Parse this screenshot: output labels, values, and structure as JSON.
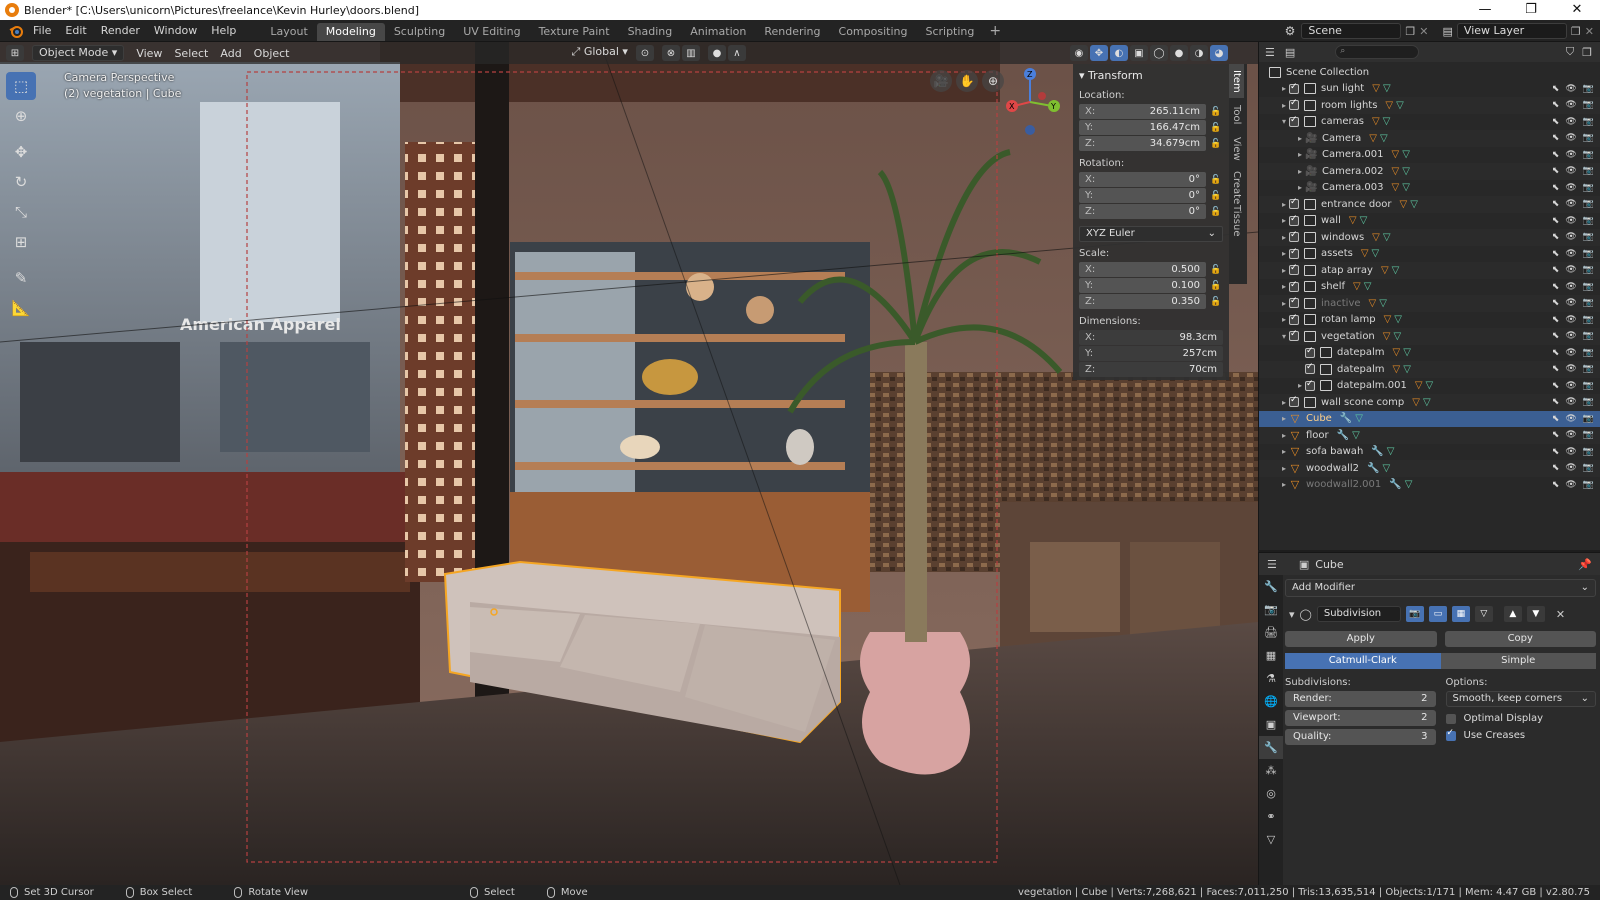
{
  "window": {
    "title": "Blender* [C:\\Users\\unicorn\\Pictures\\freelance\\Kevin Hurley\\doors.blend]",
    "minimize": "—",
    "maximize": "❐",
    "close": "✕"
  },
  "menu": [
    "File",
    "Edit",
    "Render",
    "Window",
    "Help"
  ],
  "workspaces": [
    {
      "label": "Layout",
      "active": false
    },
    {
      "label": "Modeling",
      "active": true
    },
    {
      "label": "Sculpting",
      "active": false
    },
    {
      "label": "UV Editing",
      "active": false
    },
    {
      "label": "Texture Paint",
      "active": false
    },
    {
      "label": "Shading",
      "active": false
    },
    {
      "label": "Animation",
      "active": false
    },
    {
      "label": "Rendering",
      "active": false
    },
    {
      "label": "Compositing",
      "active": false
    },
    {
      "label": "Scripting",
      "active": false
    }
  ],
  "workspace_add": "+",
  "scene_name": "Scene",
  "view_layer": "View Layer",
  "viewport": {
    "mode": "Object Mode",
    "menus": [
      "View",
      "Select",
      "Add",
      "Object"
    ],
    "orientation": "Global",
    "overlay_line1": "Camera Perspective",
    "overlay_line2": "(2) vegetation | Cube",
    "sign_text": "American Apparel"
  },
  "npanel": {
    "title": "Transform",
    "location_label": "Location:",
    "location": [
      {
        "axis": "X:",
        "value": "265.11cm"
      },
      {
        "axis": "Y:",
        "value": "166.47cm"
      },
      {
        "axis": "Z:",
        "value": "34.679cm"
      }
    ],
    "rotation_label": "Rotation:",
    "rotation": [
      {
        "axis": "X:",
        "value": "0°"
      },
      {
        "axis": "Y:",
        "value": "0°"
      },
      {
        "axis": "Z:",
        "value": "0°"
      }
    ],
    "rotation_mode": "XYZ Euler",
    "scale_label": "Scale:",
    "scale": [
      {
        "axis": "X:",
        "value": "0.500"
      },
      {
        "axis": "Y:",
        "value": "0.100"
      },
      {
        "axis": "Z:",
        "value": "0.350"
      }
    ],
    "dimensions_label": "Dimensions:",
    "dimensions": [
      {
        "axis": "X:",
        "value": "98.3cm"
      },
      {
        "axis": "Y:",
        "value": "257cm"
      },
      {
        "axis": "Z:",
        "value": "70cm"
      }
    ],
    "tabs": [
      "Item",
      "Tool",
      "View",
      "Create",
      "Tissue"
    ]
  },
  "outliner": {
    "root": "Scene Collection",
    "items": [
      {
        "name": "sun light",
        "kind": "collection",
        "depth": 1,
        "arrow": "▸",
        "state": "normal"
      },
      {
        "name": "room lights",
        "kind": "collection",
        "depth": 1,
        "arrow": "▸",
        "state": "normal"
      },
      {
        "name": "cameras",
        "kind": "collection",
        "depth": 1,
        "arrow": "▾",
        "state": "normal"
      },
      {
        "name": "Camera",
        "kind": "camera",
        "depth": 2,
        "arrow": "▸",
        "state": "normal"
      },
      {
        "name": "Camera.001",
        "kind": "camera",
        "depth": 2,
        "arrow": "▸",
        "state": "normal"
      },
      {
        "name": "Camera.002",
        "kind": "camera",
        "depth": 2,
        "arrow": "▸",
        "state": "normal"
      },
      {
        "name": "Camera.003",
        "kind": "camera",
        "depth": 2,
        "arrow": "▸",
        "state": "normal"
      },
      {
        "name": "entrance door",
        "kind": "collection",
        "depth": 1,
        "arrow": "▸",
        "state": "normal"
      },
      {
        "name": "wall",
        "kind": "collection",
        "depth": 1,
        "arrow": "▸",
        "state": "normal"
      },
      {
        "name": "windows",
        "kind": "collection",
        "depth": 1,
        "arrow": "▸",
        "state": "normal"
      },
      {
        "name": "assets",
        "kind": "collection",
        "depth": 1,
        "arrow": "▸",
        "state": "normal"
      },
      {
        "name": "atap array",
        "kind": "collection",
        "depth": 1,
        "arrow": "▸",
        "state": "normal"
      },
      {
        "name": "shelf",
        "kind": "collection",
        "depth": 1,
        "arrow": "▸",
        "state": "normal"
      },
      {
        "name": "inactive",
        "kind": "collection",
        "depth": 1,
        "arrow": "▸",
        "state": "dim"
      },
      {
        "name": "rotan lamp",
        "kind": "collection",
        "depth": 1,
        "arrow": "▸",
        "state": "normal"
      },
      {
        "name": "vegetation",
        "kind": "collection",
        "depth": 1,
        "arrow": "▾",
        "state": "normal"
      },
      {
        "name": "datepalm",
        "kind": "collection",
        "depth": 2,
        "arrow": "",
        "state": "normal"
      },
      {
        "name": "datepalm",
        "kind": "collection",
        "depth": 2,
        "arrow": "",
        "state": "normal"
      },
      {
        "name": "datepalm.001",
        "kind": "collection",
        "depth": 2,
        "arrow": "▸",
        "state": "normal"
      },
      {
        "name": "wall scone comp",
        "kind": "collection",
        "depth": 1,
        "arrow": "▸",
        "state": "normal"
      },
      {
        "name": "Cube",
        "kind": "mesh",
        "depth": 1,
        "arrow": "▸",
        "state": "selected"
      },
      {
        "name": "floor",
        "kind": "mesh",
        "depth": 1,
        "arrow": "▸",
        "state": "normal"
      },
      {
        "name": "sofa bawah",
        "kind": "mesh",
        "depth": 1,
        "arrow": "▸",
        "state": "normal"
      },
      {
        "name": "woodwall2",
        "kind": "mesh",
        "depth": 1,
        "arrow": "▸",
        "state": "normal"
      },
      {
        "name": "woodwall2.001",
        "kind": "mesh",
        "depth": 1,
        "arrow": "▸",
        "state": "dim"
      }
    ]
  },
  "properties": {
    "object_name": "Cube",
    "add_modifier": "Add Modifier",
    "modifier_name": "Subdivision",
    "apply": "Apply",
    "copy": "Copy",
    "algo_catmull": "Catmull-Clark",
    "algo_simple": "Simple",
    "subdivisions_label": "Subdivisions:",
    "render_label": "Render:",
    "render_value": "2",
    "viewport_label": "Viewport:",
    "viewport_value": "2",
    "quality_label": "Quality:",
    "quality_value": "3",
    "options_label": "Options:",
    "uv_smooth": "Smooth, keep corners",
    "optimal_display": "Optimal Display",
    "use_creases": "Use Creases"
  },
  "statusbar": {
    "set_cursor": "Set 3D Cursor",
    "box_select": "Box Select",
    "rotate_view": "Rotate View",
    "select": "Select",
    "move": "Move",
    "stats": "vegetation | Cube | Verts:7,268,621 | Faces:7,011,250 | Tris:13,635,514 | Objects:1/171 | Mem: 4.47 GB | v2.80.75"
  },
  "colors": {
    "accent": "#4772b3",
    "selection_outline": "#f5a623",
    "object_orange": "#e58b26"
  }
}
